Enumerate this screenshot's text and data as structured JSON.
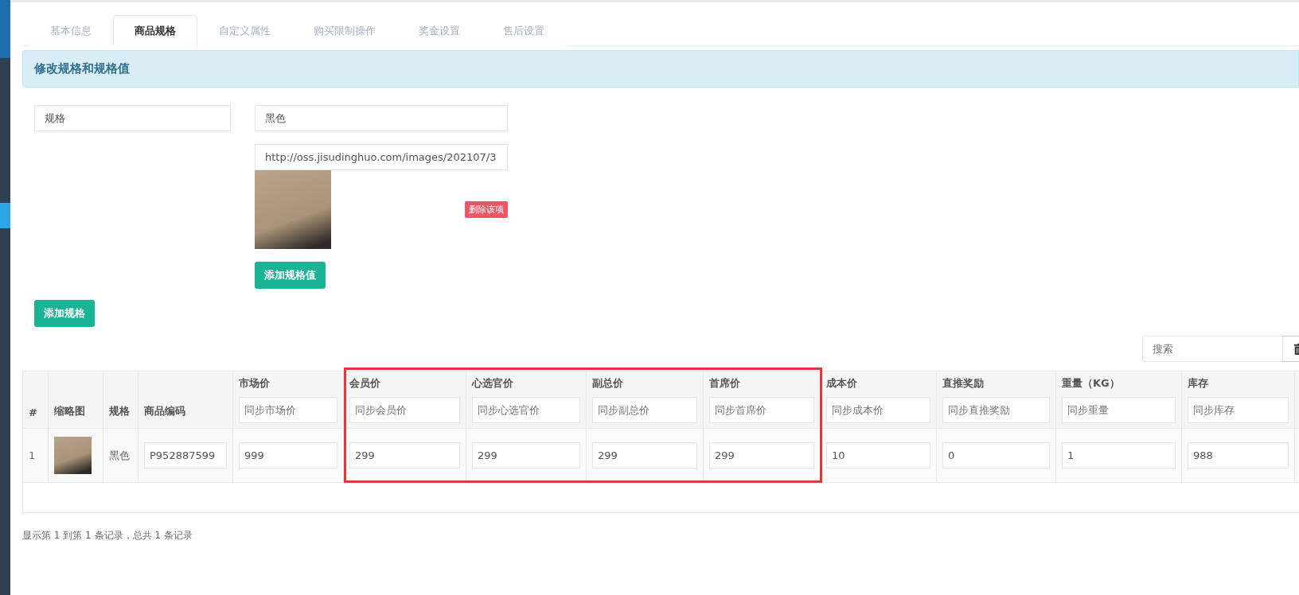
{
  "tabs": [
    {
      "label": "基本信息",
      "selected": false
    },
    {
      "label": "商品规格",
      "selected": true
    },
    {
      "label": "自定义属性",
      "selected": false
    },
    {
      "label": "购买限制操作",
      "selected": false
    },
    {
      "label": "奖金设置",
      "selected": false
    },
    {
      "label": "售后设置",
      "selected": false
    }
  ],
  "panel_title": "修改规格和规格值",
  "spec": {
    "name": "规格",
    "values": [
      {
        "value": "黑色",
        "image_url": "http://oss.jisudinghuo.com/images/202107/3",
        "delete_label": "删除该项"
      }
    ],
    "add_value_button": "添加规格值"
  },
  "add_spec_button": "添加规格",
  "search": {
    "placeholder": "搜索"
  },
  "table": {
    "column_groups": [
      {
        "columns": [
          {
            "label": "#"
          },
          {
            "label": "缩略图"
          },
          {
            "label": "规格"
          },
          {
            "label": "商品编码"
          },
          {
            "label": "市场价",
            "placeholder": "同步市场价"
          }
        ]
      },
      {
        "highlighted": true,
        "columns": [
          {
            "label": "会员价",
            "placeholder": "同步会员价"
          },
          {
            "label": "心选官价",
            "placeholder": "同步心选官价"
          },
          {
            "label": "副总价",
            "placeholder": "同步副总价"
          },
          {
            "label": "首席价",
            "placeholder": "同步首席价"
          }
        ]
      },
      {
        "columns": [
          {
            "label": "成本价",
            "placeholder": "同步成本价"
          },
          {
            "label": "直推奖励",
            "placeholder": "同步直推奖励"
          },
          {
            "label": "重量（KG）",
            "placeholder": "同步重量"
          },
          {
            "label": "库存",
            "placeholder": "同步库存"
          }
        ]
      }
    ],
    "rows": [
      {
        "index": "1",
        "spec": "黑色",
        "code": "P952887599",
        "values": [
          "999",
          "299",
          "299",
          "299",
          "299",
          "10",
          "0",
          "1",
          "988"
        ]
      }
    ]
  },
  "footer": "显示第 1 到第 1 条记录，总共 1 条记录"
}
